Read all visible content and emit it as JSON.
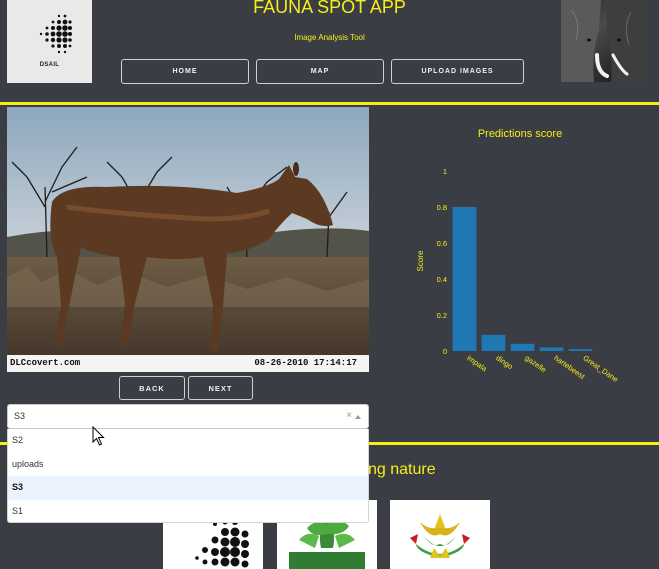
{
  "header": {
    "title": "FAUNA SPOT APP",
    "subtitle": "Image Analysis Tool",
    "logo_text": "DSAIL",
    "nav": [
      {
        "label": "HOME"
      },
      {
        "label": "MAP"
      },
      {
        "label": "UPLOAD IMAGES"
      }
    ]
  },
  "photo": {
    "watermark": "DLCcovert.com",
    "timestamp": "08-26-2010   17:14:17"
  },
  "controls": {
    "back_label": "BACK",
    "next_label": "NEXT"
  },
  "dropdown": {
    "value": "S3",
    "clear_glyph": "×",
    "options": [
      {
        "label": "S2",
        "selected": false
      },
      {
        "label": "uploads",
        "selected": false
      },
      {
        "label": "S3",
        "selected": true
      },
      {
        "label": "S1",
        "selected": false
      }
    ]
  },
  "footer": {
    "title_fragment": "ng nature"
  },
  "colors": {
    "background": "#3a3d44",
    "accent": "#f5ef19",
    "bar": "#1f77b4"
  },
  "chart_data": {
    "type": "bar",
    "title": "Predictions score",
    "ylabel": "Score",
    "xlabel": "",
    "categories": [
      "impala",
      "dingo",
      "gazelle",
      "hartebeest",
      "Great_Dane"
    ],
    "values": [
      0.8,
      0.09,
      0.04,
      0.02,
      0.01
    ],
    "ylim": [
      0,
      1
    ],
    "yticks": [
      0,
      0.2,
      0.4,
      0.6,
      0.8,
      1
    ],
    "grid": false,
    "legend": "none"
  }
}
